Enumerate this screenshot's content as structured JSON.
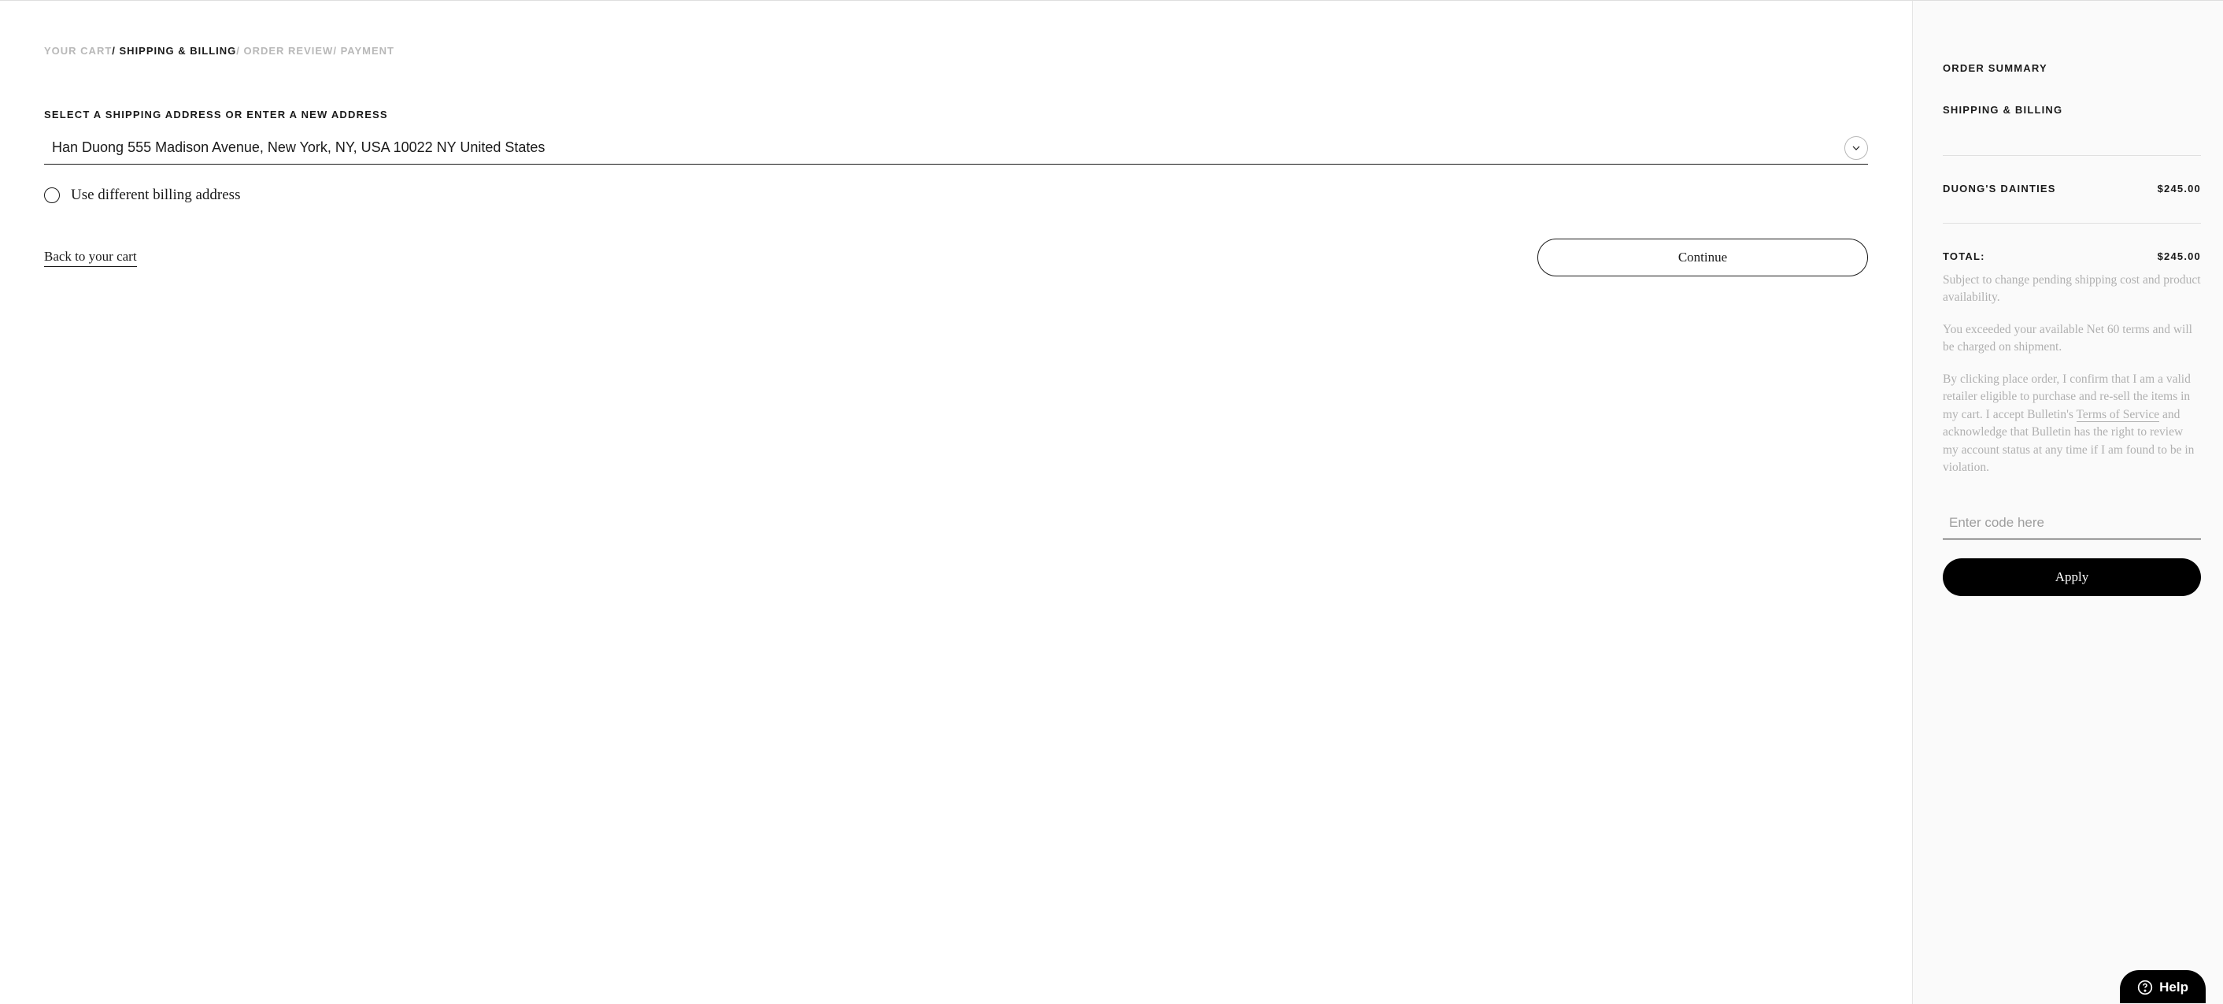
{
  "breadcrumb": {
    "cart": "YOUR CART",
    "shipping": "SHIPPING & BILLING",
    "review": "ORDER REVIEW",
    "payment": "PAYMENT",
    "separator": "/ "
  },
  "main": {
    "section_label": "SELECT A SHIPPING ADDRESS OR ENTER A NEW ADDRESS",
    "selected_address": "Han Duong 555 Madison Avenue, New York, NY, USA 10022 NY United States",
    "billing_option_label": "Use different billing address",
    "back_link": "Back to your cart",
    "continue_label": "Continue"
  },
  "summary": {
    "title": "ORDER SUMMARY",
    "step": "SHIPPING & BILLING",
    "vendor_name": "DUONG'S DAINTIES",
    "vendor_amount": "$245.00",
    "total_label": "TOTAL:",
    "total_amount": "$245.00",
    "note_change": "Subject to change pending shipping cost and product availability.",
    "note_net60": "You exceeded your available Net 60 terms and will be charged on shipment.",
    "disclaimer_prefix": "By clicking place order, I confirm that I am a valid retailer eligible to purchase and re-sell the items in my cart. I accept Bulletin's ",
    "tos_link": "Terms of Service",
    "disclaimer_suffix": " and acknowledge that Bulletin has the right to review my account status at any time if I am found to be in violation.",
    "promo_placeholder": "Enter code here",
    "apply_label": "Apply"
  },
  "help": {
    "label": "Help"
  }
}
